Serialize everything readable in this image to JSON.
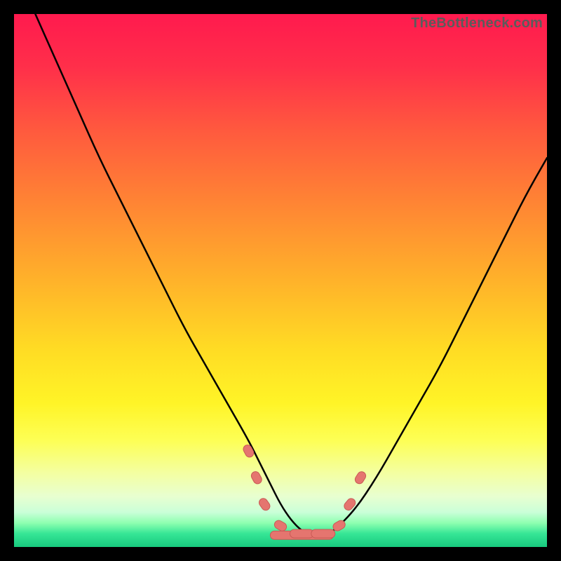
{
  "watermark": "TheBottleneck.com",
  "gradient_stops": [
    {
      "offset": 0.0,
      "color": "#ff1a4e"
    },
    {
      "offset": 0.1,
      "color": "#ff2f4a"
    },
    {
      "offset": 0.22,
      "color": "#ff5a3e"
    },
    {
      "offset": 0.35,
      "color": "#ff8334"
    },
    {
      "offset": 0.5,
      "color": "#ffb22a"
    },
    {
      "offset": 0.63,
      "color": "#ffdc24"
    },
    {
      "offset": 0.73,
      "color": "#fff427"
    },
    {
      "offset": 0.8,
      "color": "#fdff55"
    },
    {
      "offset": 0.86,
      "color": "#f4ffa0"
    },
    {
      "offset": 0.905,
      "color": "#e8ffd0"
    },
    {
      "offset": 0.935,
      "color": "#caffd8"
    },
    {
      "offset": 0.955,
      "color": "#8effb0"
    },
    {
      "offset": 0.975,
      "color": "#36e696"
    },
    {
      "offset": 1.0,
      "color": "#18c97e"
    }
  ],
  "marker_color": "#e5756f",
  "marker_stroke": "#c95a55",
  "curve_color": "#000000",
  "chart_data": {
    "type": "line",
    "title": "",
    "xlabel": "",
    "ylabel": "",
    "xlim": [
      0,
      100
    ],
    "ylim": [
      0,
      100
    ],
    "x": [
      4,
      8,
      12,
      16,
      20,
      24,
      28,
      32,
      36,
      40,
      44,
      46,
      48,
      50,
      52,
      54,
      56,
      58,
      60,
      64,
      68,
      72,
      76,
      80,
      84,
      88,
      92,
      96,
      100
    ],
    "y": [
      100,
      91,
      82,
      73,
      65,
      57,
      49,
      41,
      34,
      27,
      20,
      16,
      12,
      8,
      5,
      3,
      2,
      2,
      3,
      7,
      13,
      20,
      27,
      34,
      42,
      50,
      58,
      66,
      73
    ],
    "markers": [
      {
        "x": 44,
        "y": 18
      },
      {
        "x": 45.5,
        "y": 13
      },
      {
        "x": 47,
        "y": 8
      },
      {
        "x": 50,
        "y": 4
      },
      {
        "x": 54,
        "y": 2.5
      },
      {
        "x": 58,
        "y": 2.5
      },
      {
        "x": 61,
        "y": 4
      },
      {
        "x": 63,
        "y": 8
      },
      {
        "x": 65,
        "y": 13
      }
    ],
    "note": "x and y are in percent of the plot area (0 = left/bottom, 100 = right/top). Values read by eye; chart has no axis labels or ticks. Curve is a bottleneck-style V with minimum near x≈56."
  }
}
